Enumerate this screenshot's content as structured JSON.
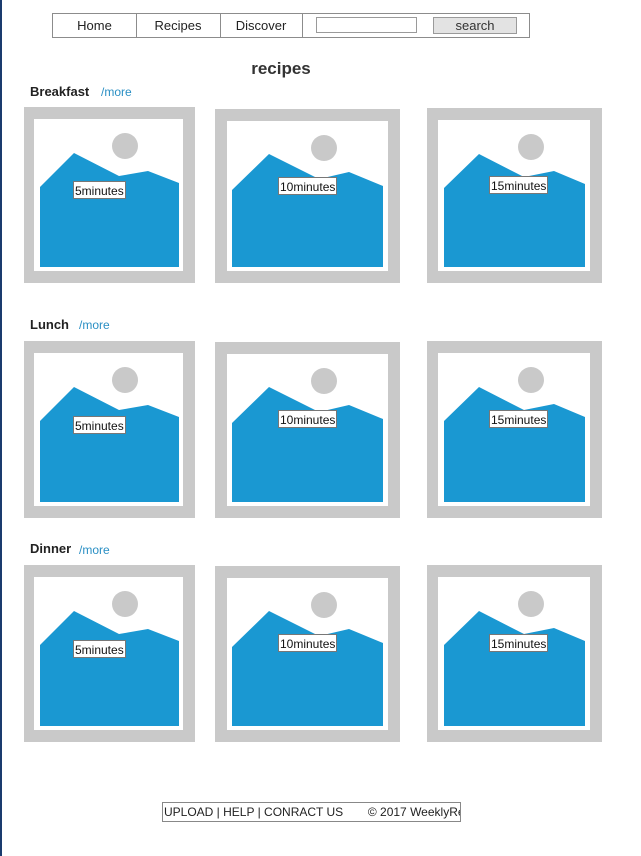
{
  "nav": {
    "items": [
      "Home",
      "Recipes",
      "Discover"
    ],
    "search_placeholder": "",
    "search_button": "search"
  },
  "page_title": "recipes",
  "sections": [
    {
      "title": "Breakfast",
      "more": "/more",
      "times": [
        "5minutes",
        "10minutes",
        "15minutes"
      ]
    },
    {
      "title": "Lunch",
      "more": "/more",
      "times": [
        "5minutes",
        "10minutes",
        "15minutes"
      ]
    },
    {
      "title": "Dinner",
      "more": "/more",
      "times": [
        "5minutes",
        "10minutes",
        "15minutes"
      ]
    }
  ],
  "colors": {
    "image_blue": "#1a98d2",
    "frame_gray": "#c9c9c9",
    "sun_gray": "#c9c9c9"
  },
  "footer": {
    "links": "UPLOAD | HELP | CONRACT US",
    "copyright": "© 2017 WeeklyRe"
  }
}
